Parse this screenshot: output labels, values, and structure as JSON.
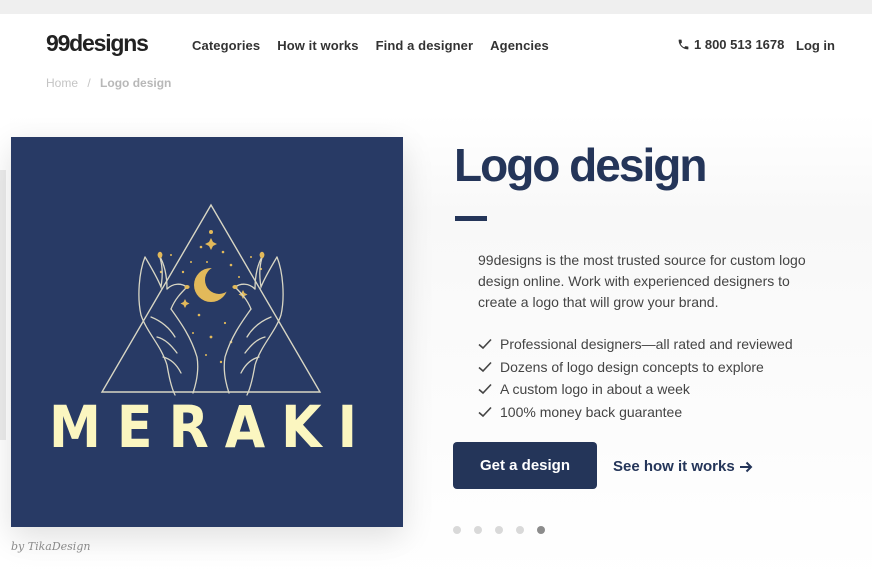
{
  "header": {
    "logo": "99designs",
    "nav": [
      "Categories",
      "How it works",
      "Find a designer",
      "Agencies"
    ],
    "phone": "1 800 513 1678",
    "login": "Log in"
  },
  "breadcrumb": {
    "home": "Home",
    "separator": "/",
    "current": "Logo design"
  },
  "hero": {
    "image_text": "MERAKI",
    "caption": "by TikaDesign",
    "title": "Logo design",
    "description": "99designs is the most trusted source for custom logo design online. Work with experienced designers to create a logo that will grow your brand.",
    "checks": [
      "Professional designers—all rated and reviewed",
      "Dozens of logo design concepts to explore",
      "A custom logo in about a week",
      "100% money back guarantee"
    ],
    "cta": "Get a design",
    "secondary_link": "See how it works",
    "carousel": {
      "count": 5,
      "active_index": 4
    }
  },
  "colors": {
    "brand_navy": "#243559",
    "image_bg": "#283a65",
    "gold": "#e2b95a",
    "cream": "#fbf6c0"
  }
}
